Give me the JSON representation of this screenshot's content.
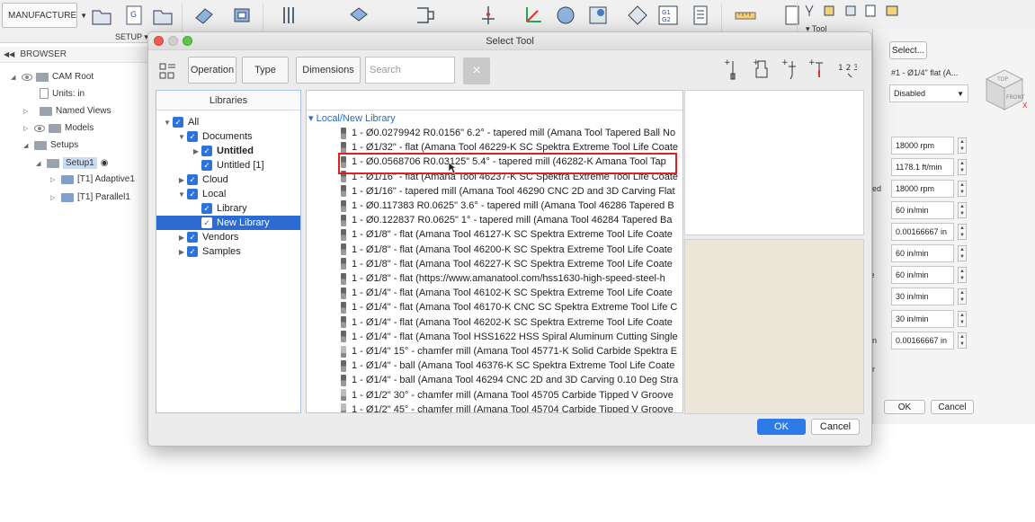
{
  "toolbar": {
    "workspace": "MANUFACTURE",
    "setup_label": "SETUP ▾",
    "tool_label": "▾ Tool"
  },
  "browser": {
    "header": "BROWSER",
    "items": [
      {
        "label": "CAM Root"
      },
      {
        "label": "Units: in"
      },
      {
        "label": "Named Views"
      },
      {
        "label": "Models"
      },
      {
        "label": "Setups"
      },
      {
        "label": "Setup1"
      },
      {
        "label": "[T1] Adaptive1"
      },
      {
        "label": "[T1] Parallel1"
      }
    ]
  },
  "right_panel": {
    "select_button": "Select...",
    "tool_desc": "#1 - Ø1/4\" flat (A...",
    "coolant": "Disabled",
    "fields": [
      {
        "value": "18000 rpm"
      },
      {
        "value": "1178.1 ft/min"
      },
      {
        "value": "18000 rpm",
        "label": "eed"
      },
      {
        "value": "60 in/min"
      },
      {
        "value": "0.00166667 in"
      },
      {
        "value": "60 in/min"
      },
      {
        "value": "60 in/min",
        "label": "te"
      },
      {
        "value": "30 in/min"
      },
      {
        "value": "30 in/min"
      },
      {
        "value": "0.00166667 in",
        "label": "on"
      }
    ],
    "extra_label": "r",
    "ok": "OK",
    "cancel": "Cancel"
  },
  "nav_cube": {
    "top": "TOP",
    "front": "FRONT",
    "axis": "X"
  },
  "dialog": {
    "title": "Select Tool",
    "filters": {
      "operation": "Operation",
      "type": "Type",
      "dimensions": "Dimensions",
      "search_placeholder": "Search",
      "clear": "×"
    },
    "number_icon_label": "1 2 3",
    "libraries": {
      "header": "Libraries",
      "items": [
        {
          "label": "All",
          "level": 0,
          "expanded": true,
          "bold": false
        },
        {
          "label": "Documents",
          "level": 1,
          "expanded": true,
          "bold": false
        },
        {
          "label": "Untitled",
          "level": 2,
          "expanded": false,
          "bold": true
        },
        {
          "label": "Untitled [1]",
          "level": 2,
          "expanded": null,
          "bold": false
        },
        {
          "label": "Cloud",
          "level": 1,
          "expanded": false,
          "bold": false
        },
        {
          "label": "Local",
          "level": 1,
          "expanded": true,
          "bold": false
        },
        {
          "label": "Library",
          "level": 2,
          "expanded": null,
          "bold": false
        },
        {
          "label": "New Library",
          "level": 2,
          "expanded": null,
          "bold": false,
          "selected": true
        },
        {
          "label": "Vendors",
          "level": 1,
          "expanded": false,
          "bold": false
        },
        {
          "label": "Samples",
          "level": 1,
          "expanded": false,
          "bold": false
        }
      ]
    },
    "section_title": "▾ Local/New Library",
    "tools": [
      "1 - Ø0.0279942 R0.0156\" 6.2° - tapered mill (Amana Tool Tapered Ball No",
      "1 - Ø1/32\" - flat (Amana Tool 46229-K SC Spektra Extreme Tool Life Coate",
      "1 - Ø0.0568706 R0.03125\" 5.4° - tapered mill (46282-K Amana Tool Tap",
      "1 - Ø1/16\" - flat (Amana Tool 46237-K SC Spektra Extreme Tool Life Coate",
      "1 - Ø1/16\" - tapered mill (Amana Tool 46290 CNC 2D and 3D Carving Flat",
      "1 - Ø0.117383 R0.0625\" 3.6° - tapered mill (Amana Tool 46286 Tapered B",
      "1 - Ø0.122837 R0.0625\" 1° - tapered mill (Amana Tool 46284 Tapered Ba",
      "1 - Ø1/8\" - flat (Amana Tool 46127-K SC Spektra Extreme Tool Life Coate",
      "1 - Ø1/8\" - flat (Amana Tool 46200-K SC Spektra Extreme Tool Life Coate",
      "1 - Ø1/8\" - flat (Amana Tool 46227-K SC Spektra Extreme Tool Life Coate",
      "1 - Ø1/8\" - flat (https://www.amanatool.com/hss1630-high-speed-steel-h",
      "1 - Ø1/4\" - flat (Amana Tool 46102-K SC Spektra Extreme Tool Life Coate",
      "1 - Ø1/4\" - flat (Amana Tool 46170-K CNC SC Spektra Extreme Tool Life C",
      "1 - Ø1/4\" - flat (Amana Tool 46202-K SC Spektra Extreme Tool Life Coate",
      "1 - Ø1/4\" - flat (Amana Tool HSS1622 HSS Spiral Aluminum Cutting Single",
      "1 - Ø1/4\" 15° - chamfer mill (Amana Tool 45771-K Solid Carbide Spektra E",
      "1 - Ø1/4\" - ball (Amana Tool 46376-K SC Spektra Extreme Tool Life Coate",
      "1 - Ø1/4\" - ball (Amana Tool 46294 CNC 2D and 3D Carving 0.10 Deg Stra",
      "1 - Ø1/2\" 30° - chamfer mill (Amana Tool 45705 Carbide Tipped V Groove",
      "1 - Ø1/2\" 45° - chamfer mill (Amana Tool 45704 Carbide Tipped V Groove"
    ],
    "ok": "OK",
    "cancel": "Cancel"
  },
  "colors": {
    "accent": "#2d6ad2",
    "highlight": "#e02020",
    "preview_bg": "#ebe6d8"
  }
}
